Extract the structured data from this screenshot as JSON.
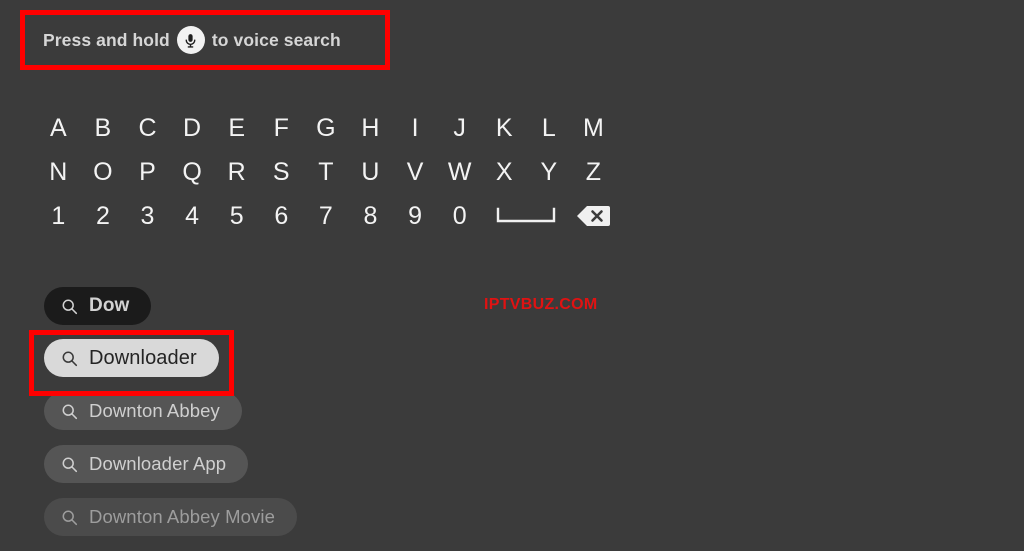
{
  "screen": {
    "background_color": "#3b3b3b",
    "highlight_color": "#ff0000"
  },
  "voice_search": {
    "prefix_text": "Press and hold",
    "suffix_text": "to voice search",
    "mic_icon": "microphone-icon",
    "highlighted": true
  },
  "keyboard": {
    "rows": [
      [
        "A",
        "B",
        "C",
        "D",
        "E",
        "F",
        "G",
        "H",
        "I",
        "J",
        "K",
        "L",
        "M"
      ],
      [
        "N",
        "O",
        "P",
        "Q",
        "R",
        "S",
        "T",
        "U",
        "V",
        "W",
        "X",
        "Y",
        "Z"
      ],
      [
        "1",
        "2",
        "3",
        "4",
        "5",
        "6",
        "7",
        "8",
        "9",
        "0"
      ]
    ],
    "space_key": {
      "label": "space-bar",
      "icon": "space-bar-icon"
    },
    "backspace_key": {
      "label": "backspace",
      "icon": "backspace-icon"
    }
  },
  "search": {
    "query_pill": {
      "text": "Dow",
      "icon": "search-icon",
      "state": "query"
    },
    "suggestions": [
      {
        "text": "Downloader",
        "icon": "search-icon",
        "state": "selected",
        "highlighted": true
      },
      {
        "text": "Downton Abbey",
        "icon": "search-icon",
        "state": "normal",
        "highlighted": false
      },
      {
        "text": "Downloader App",
        "icon": "search-icon",
        "state": "normal",
        "highlighted": false
      },
      {
        "text": "Downton Abbey Movie",
        "icon": "search-icon",
        "state": "dim",
        "highlighted": false
      }
    ]
  },
  "watermark": {
    "text": "IPTVBUZ.COM",
    "color": "#e01212"
  }
}
